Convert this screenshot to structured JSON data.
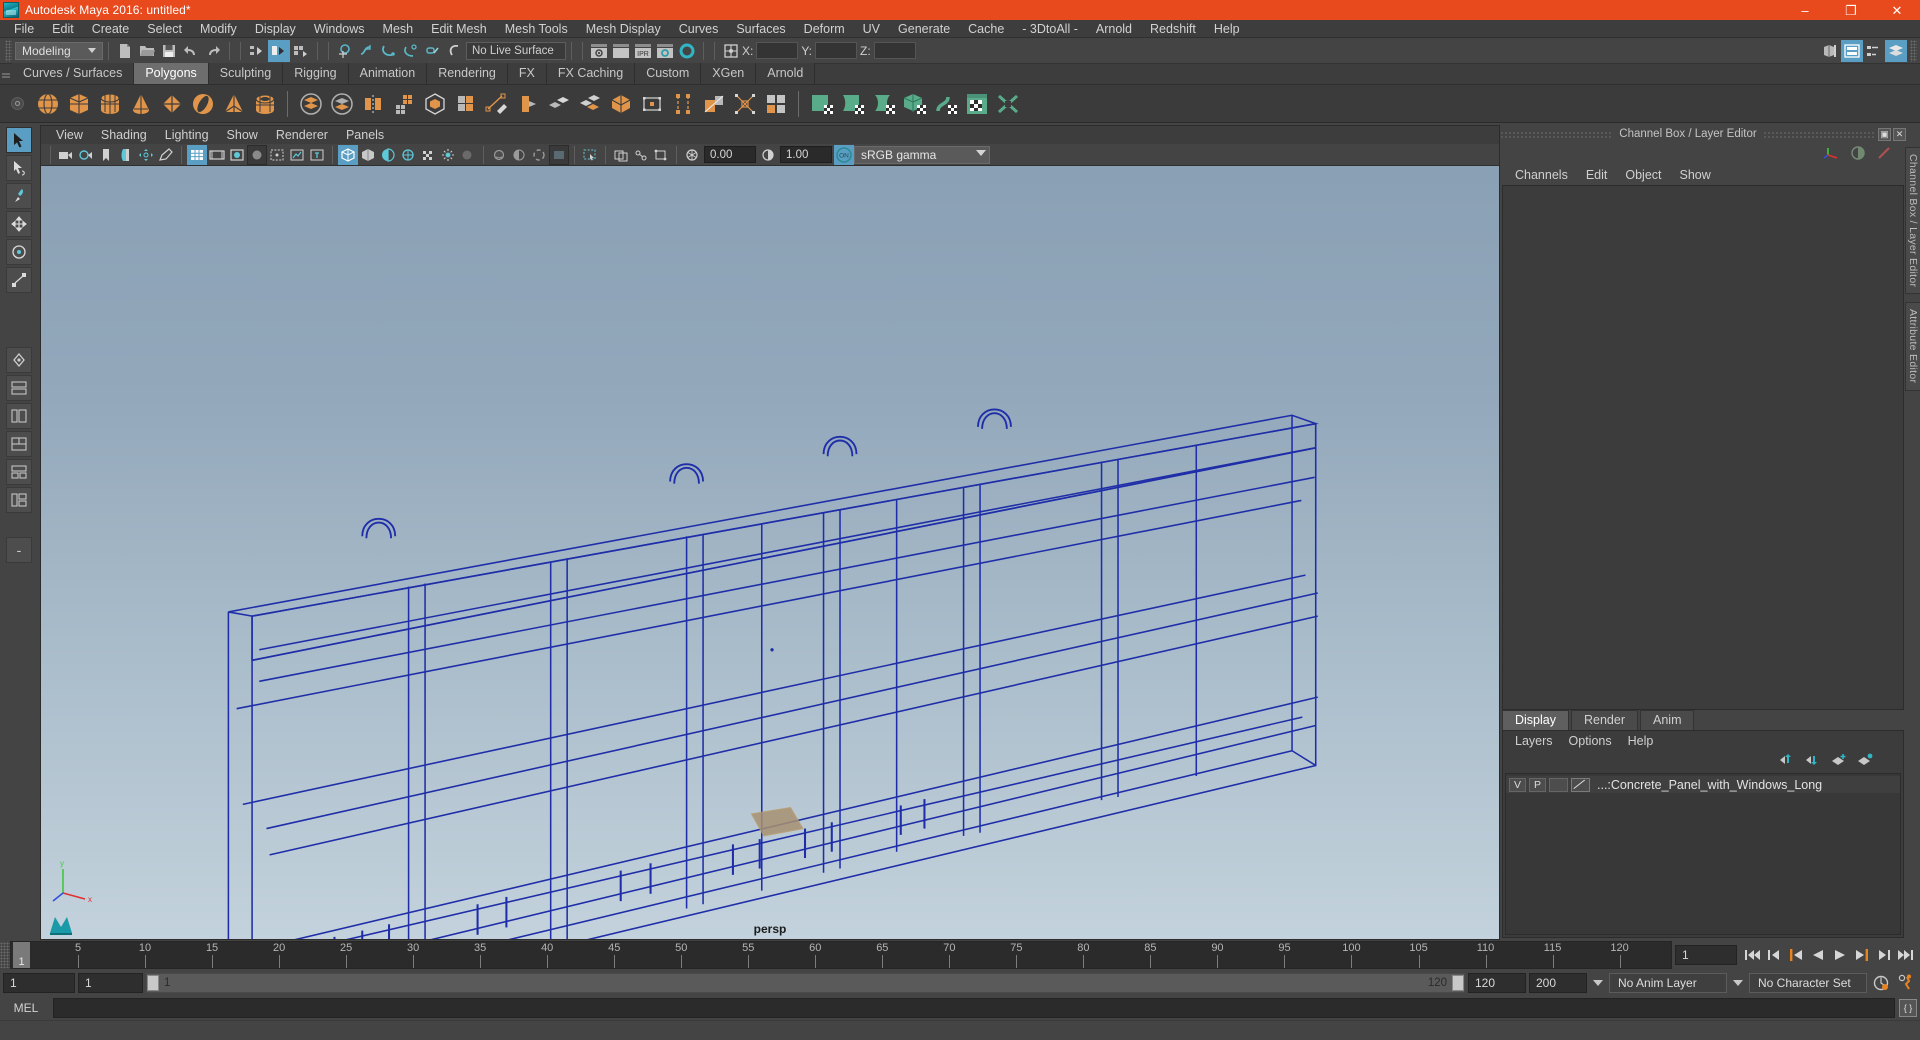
{
  "window": {
    "title": "Autodesk Maya 2016: untitled*",
    "logo_icon": "maya-logo-icon",
    "controls": {
      "minimize": "–",
      "maximize": "❐",
      "close": "✕"
    }
  },
  "menubar": [
    "File",
    "Edit",
    "Create",
    "Select",
    "Modify",
    "Display",
    "Windows",
    "Mesh",
    "Edit Mesh",
    "Mesh Tools",
    "Mesh Display",
    "Curves",
    "Surfaces",
    "Deform",
    "UV",
    "Generate",
    "Cache",
    "- 3DtoAll -",
    "Arnold",
    "Redshift",
    "Help"
  ],
  "statusbar": {
    "mode": "Modeling",
    "live_surface": "No Live Surface",
    "coords": {
      "x_label": "X:",
      "y_label": "Y:",
      "z_label": "Z:",
      "x_value": "",
      "y_value": "",
      "z_value": ""
    },
    "icons": [
      "new-scene-icon",
      "open-scene-icon",
      "save-scene-icon",
      "undo-icon",
      "redo-icon",
      "select-by-hierarchy-icon",
      "select-by-object-icon",
      "select-by-component-icon",
      "snap-to-grid-icon",
      "snap-to-curve-icon",
      "snap-to-point-icon",
      "snap-to-projected-center-icon",
      "snap-to-view-plane-icon",
      "make-live-icon",
      "render-view-icon",
      "render-region-icon",
      "ipr-render-icon",
      "render-settings-icon",
      "hypershade-icon",
      "input-output-connections-icon"
    ],
    "right_icons": [
      "show-hide-modeling-toolkit-icon",
      "attribute-editor-icon",
      "tool-settings-icon",
      "channel-box-layer-editor-icon"
    ]
  },
  "shelf": {
    "tabs": [
      "Curves / Surfaces",
      "Polygons",
      "Sculpting",
      "Rigging",
      "Animation",
      "Rendering",
      "FX",
      "FX Caching",
      "Custom",
      "XGen",
      "Arnold"
    ],
    "active_tab": "Polygons",
    "icons": [
      "poly-sphere-icon",
      "poly-cube-icon",
      "poly-cylinder-icon",
      "poly-cone-icon",
      "poly-plane-icon",
      "poly-torus-icon",
      "poly-pyramid-icon",
      "poly-pipe-icon",
      "sep",
      "combine-icon",
      "separate-icon",
      "mirror-geometry-icon",
      "smooth-icon",
      "boolean-icon",
      "extrude-icon",
      "create-polygon-tool-icon",
      "multi-cut-icon",
      "bevel-icon",
      "sculpt-geometry-icon",
      "wedge-face-icon",
      "poly-extrude-icon",
      "bridge-icon",
      "append-polygon-icon",
      "transform-component-icon",
      "quadrangulate-icon",
      "sep",
      "uv-planar-icon",
      "uv-cylindrical-icon",
      "uv-spherical-icon",
      "uv-automatic-icon",
      "uv-unfold-icon",
      "uv-editor-icon",
      "uv-layout-icon"
    ]
  },
  "viewport_panel": {
    "menus": [
      "View",
      "Shading",
      "Lighting",
      "Show",
      "Renderer",
      "Panels"
    ],
    "camera_label": "persp",
    "toolbar": {
      "exposure_value": "0.00",
      "gamma_value": "1.00",
      "color_management_icon": "color-management-on-icon",
      "color_profile": "sRGB gamma",
      "icons": [
        "select-camera-icon",
        "lock-camera-icon",
        "bookmark-icon",
        "image-plane-icon",
        "two-d-pan-zoom-icon",
        "grease-pencil-icon",
        "grid-icon",
        "film-gate-icon",
        "resolution-gate-icon",
        "gate-mask-icon",
        "film-origin-icon",
        "safe-action-icon",
        "title-safe-icon",
        "wireframe-icon",
        "smooth-shade-all-icon",
        "shade-selected-icon",
        "wireframe-on-shaded-icon",
        "textured-icon",
        "use-all-lights-icon",
        "shadows-icon",
        "screen-space-ao-icon",
        "motion-blur-icon",
        "multisample-icon",
        "depth-of-field-icon",
        "isolate-select-icon",
        "xray-icon",
        "xray-joints-icon",
        "xray-active-components-icon"
      ]
    }
  },
  "channel_box": {
    "panel_title": "Channel Box / Layer Editor",
    "menus": [
      "Channels",
      "Edit",
      "Object",
      "Show"
    ],
    "header_icons": [
      "undock-icon",
      "close-panel-icon"
    ],
    "tool_icons": [
      "show-manipulators-icon",
      "channel-box-icon",
      "attribute-editor-icon"
    ],
    "side_tabs": [
      "Channel Box / Layer Editor",
      "Attribute Editor"
    ]
  },
  "layer_editor": {
    "tabs": [
      "Display",
      "Render",
      "Anim"
    ],
    "active_tab": "Display",
    "menus": [
      "Layers",
      "Options",
      "Help"
    ],
    "buttons": [
      "move-layer-up-icon",
      "move-layer-down-icon",
      "new-layer-icon",
      "new-layer-from-selected-icon"
    ],
    "layers": [
      {
        "visibility": "V",
        "playback": "P",
        "type": "",
        "name": "...:Concrete_Panel_with_Windows_Long"
      }
    ]
  },
  "timeline": {
    "current_frame_label": "1",
    "ticks": [
      5,
      10,
      15,
      20,
      25,
      30,
      35,
      40,
      45,
      50,
      55,
      60,
      65,
      70,
      75,
      80,
      85,
      90,
      95,
      100,
      105,
      110,
      115,
      120
    ],
    "end_label": "120",
    "frame_field": "1",
    "transport_icons": [
      "go-to-start-icon",
      "step-back-keyframe-icon",
      "step-back-frame-icon",
      "play-backwards-icon",
      "play-forwards-icon",
      "step-forward-frame-icon",
      "step-forward-keyframe-icon",
      "go-to-end-icon"
    ]
  },
  "range_slider": {
    "range_start": "1",
    "anim_start": "1",
    "slider_start_label": "1",
    "slider_end_label": "120",
    "anim_end": "120",
    "range_end": "200",
    "anim_layer": "No Anim Layer",
    "character_set": "No Character Set",
    "auto_key_icon": "auto-keyframe-icon",
    "anim_prefs_icon": "animation-preferences-icon"
  },
  "command_line": {
    "label": "MEL",
    "value": "",
    "script_editor_icon": "script-editor-icon"
  },
  "colors": {
    "title_bar": "#e8491d",
    "chrome": "#444444",
    "panel": "#3c3c3c",
    "accent_blue": "#5a9ec4",
    "shelf_orange": "#e0954a",
    "shelf_green": "#5aab8a",
    "wireframe": "#1f2ea8",
    "viewport_top": "#8aa0b4",
    "viewport_bottom": "#c3d2dc"
  }
}
